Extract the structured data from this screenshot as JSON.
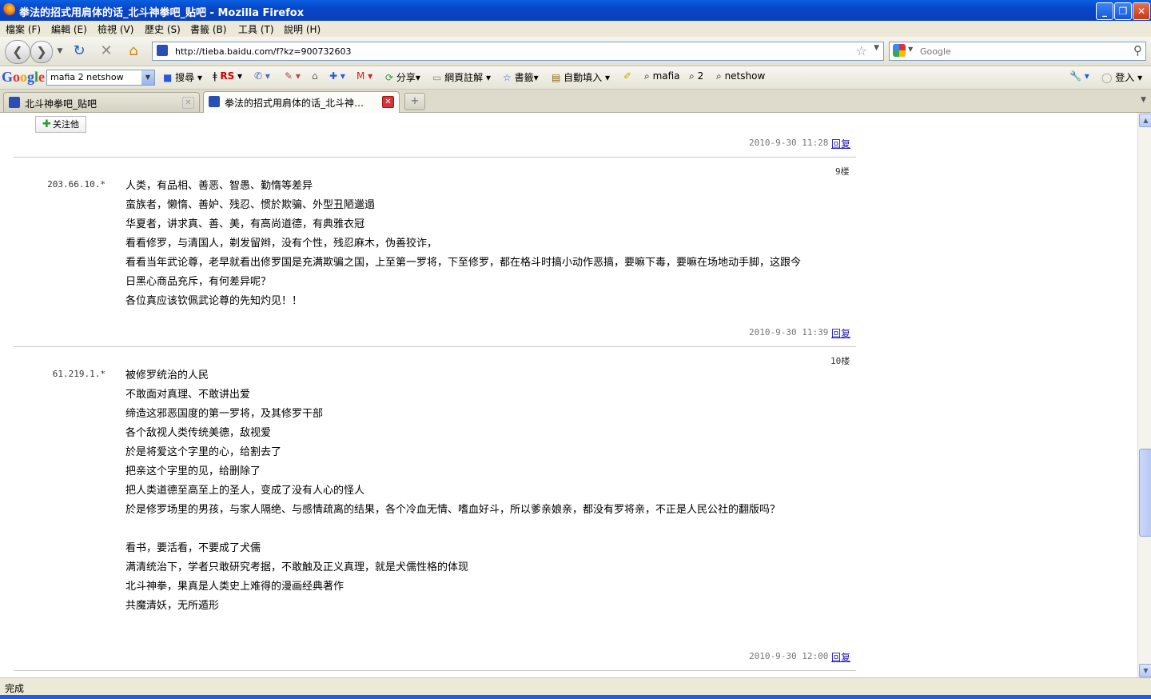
{
  "window": {
    "title": "拳法的招式用肩体的话_北斗神拳吧_贴吧 - Mozilla Firefox"
  },
  "menu": [
    "檔案 (F)",
    "編輯 (E)",
    "檢視 (V)",
    "歷史 (S)",
    "書籤 (B)",
    "工具 (T)",
    "說明 (H)"
  ],
  "nav": {
    "url": "http://tieba.baidu.com/f?kz=900732603",
    "search_placeholder": "Google"
  },
  "google_toolbar": {
    "logo": "Google",
    "query": "mafia 2 netshow",
    "search_label": "搜尋",
    "rs_label": "RS",
    "share_label": "分享",
    "translate_label": "網頁註解",
    "bookmarks_label": "書籤",
    "autofill_label": "自動填入",
    "term1": "mafia",
    "term2": "2",
    "term3": "netshow",
    "signin_label": "登入"
  },
  "tabs": [
    {
      "label": "北斗神拳吧_贴吧",
      "active": false
    },
    {
      "label": "拳法的招式用肩体的话_北斗神…",
      "active": true
    }
  ],
  "content": {
    "follow_label": "关注他",
    "posts": [
      {
        "time": "2010-9-30 11:28",
        "reply": "回复"
      },
      {
        "floor": "9楼",
        "ip": "203.66.10.*",
        "lines": [
          "人类，有品相、善恶、智愚、勤惰等差异",
          "蛮族者，懒惰、善妒、残忍、惯於欺骗、外型丑陋邋遢",
          "华夏者，讲求真、善、美，有高尚道德，有典雅衣冠",
          "看看修罗，与清国人，剃发留辫，没有个性，残忍麻木，伪善狡诈，",
          "看看当年武论尊，老早就看出修罗国是充满欺骗之国，上至第一罗将，下至修罗，都在格斗时搞小动作恶搞，要嘛下毒，要嘛在场地动手脚，这跟今",
          "日黑心商品充斥，有何差异呢？",
          "各位真应该钦佩武论尊的先知灼见！！"
        ],
        "time": "2010-9-30 11:39",
        "reply": "回复"
      },
      {
        "floor": "10楼",
        "ip": "61.219.1.*",
        "lines": [
          "被修罗统治的人民",
          "不敢面对真理、不敢讲出爱",
          "缔造这邪恶国度的第一罗将，及其修罗干部",
          "各个敌视人类传统美德，敌视爱",
          "於是将爱这个字里的心，给割去了",
          "把亲这个字里的见，给删除了",
          "把人类道德至高至上的圣人，变成了没有人心的怪人",
          "於是修罗场里的男孩，与家人隔绝、与感情疏离的结果，各个冷血无情、嗜血好斗，所以爹亲娘亲，都没有罗将亲，不正是人民公社的翻版吗？",
          "",
          "看书，要活看，不要成了犬儒",
          "满清统治下，学者只敢研究考据，不敢触及正义真理，就是犬儒性格的体现",
          "北斗神拳，果真是人类史上难得的漫画经典著作",
          "共魔清妖，无所遁形"
        ],
        "time": "2010-9-30 12:00",
        "reply": "回复"
      }
    ]
  },
  "status": "完成"
}
